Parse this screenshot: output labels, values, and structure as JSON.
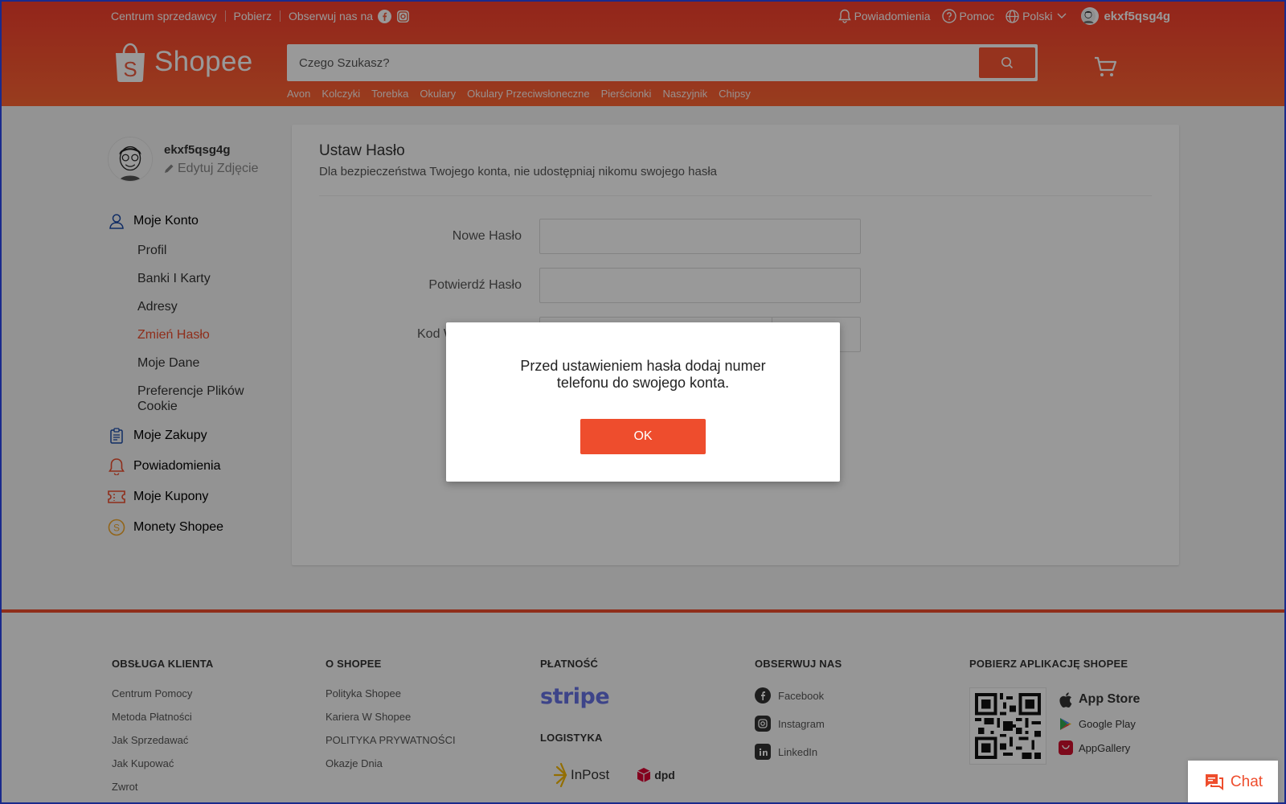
{
  "colors": {
    "brand": "#ee4d2d",
    "link_blue": "#1a2a8c",
    "text": "#222222"
  },
  "topbar": {
    "seller_center": "Centrum sprzedawcy",
    "download": "Pobierz",
    "follow": "Obserwuj nas na",
    "notifications": "Powiadomienia",
    "help": "Pomoc",
    "language": "Polski",
    "username": "ekxf5qsg4g"
  },
  "header": {
    "logo_text": "Shopee",
    "search_placeholder": "Czego Szukasz?",
    "suggestions": [
      "Avon",
      "Kolczyki",
      "Torebka",
      "Okulary",
      "Okulary Przeciwsłoneczne",
      "Pierścionki",
      "Naszyjnik",
      "Chipsy"
    ]
  },
  "sidebar": {
    "username": "ekxf5qsg4g",
    "edit_photo": "Edytuj Zdjęcie",
    "my_account": "Moje Konto",
    "sub_items": [
      {
        "label": "Profil",
        "active": false
      },
      {
        "label": "Banki I Karty",
        "active": false
      },
      {
        "label": "Adresy",
        "active": false
      },
      {
        "label": "Zmień Hasło",
        "active": true
      },
      {
        "label": "Moje Dane",
        "active": false
      },
      {
        "label": "Preferencje Plików Cookie",
        "active": false
      }
    ],
    "groups": [
      {
        "label": "Moje Zakupy",
        "icon": "clipboard-icon"
      },
      {
        "label": "Powiadomienia",
        "icon": "bell-icon"
      },
      {
        "label": "Moje Kupony",
        "icon": "ticket-icon"
      },
      {
        "label": "Monety Shopee",
        "icon": "coin-icon"
      }
    ]
  },
  "main": {
    "title": "Ustaw Hasło",
    "subtitle": "Dla bezpieczeństwa Twojego konta, nie udostępniaj nikomu swojego hasła",
    "new_password_label": "Nowe Hasło",
    "confirm_password_label": "Potwierdź Hasło",
    "code_label": "Kod Weryfikacyjny",
    "new_password_value": "",
    "confirm_password_value": ""
  },
  "modal": {
    "message": "Przed ustawieniem hasła dodaj numer telefonu do swojego konta.",
    "ok": "OK"
  },
  "footer": {
    "customer_service": {
      "title": "OBSŁUGA KLIENTA",
      "links": [
        "Centrum Pomocy",
        "Metoda Płatności",
        "Jak Sprzedawać",
        "Jak Kupować",
        "Zwrot"
      ]
    },
    "about": {
      "title": "O SHOPEE",
      "links": [
        "Polityka Shopee",
        "Kariera W Shopee",
        "POLITYKA PRYWATNOŚCI",
        "Okazje Dnia"
      ]
    },
    "payment": {
      "title": "PŁATNOŚĆ",
      "stripe": "stripe",
      "logistics_title": "LOGISTYKA",
      "inpost": "InPost",
      "dpd": "dpd"
    },
    "follow": {
      "title": "OBSERWUJ NAS",
      "links": [
        "Facebook",
        "Instagram",
        "LinkedIn"
      ]
    },
    "app": {
      "title": "POBIERZ APLIKACJĘ SHOPEE",
      "stores": [
        "App Store",
        "Google Play",
        "AppGallery"
      ]
    }
  },
  "chat": {
    "label": "Chat"
  }
}
